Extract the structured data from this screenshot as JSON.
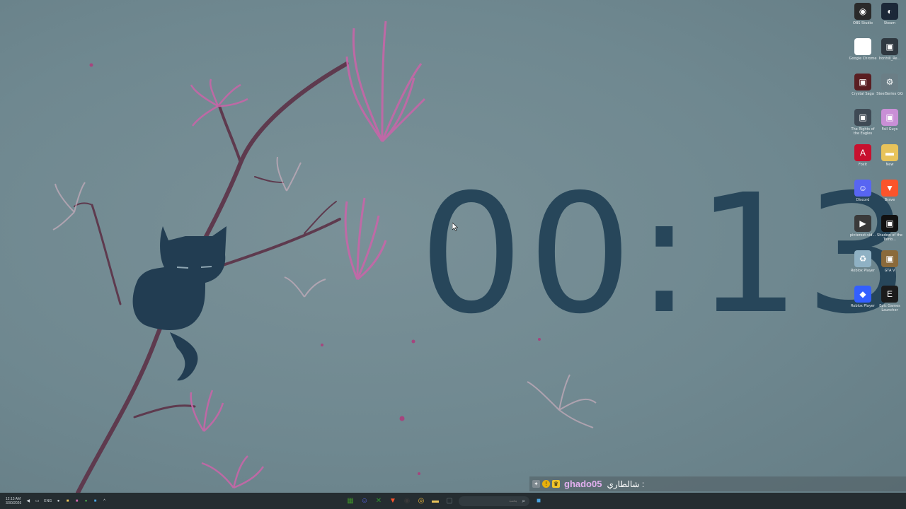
{
  "clock": {
    "time": "00:13"
  },
  "desktop_icons": [
    {
      "name": "obs-studio",
      "label": "OBS Studio",
      "icon": "obs-icon",
      "color": "#2a2a2a"
    },
    {
      "name": "steam",
      "label": "Steam",
      "icon": "steam-icon",
      "color": "#1b2838"
    },
    {
      "name": "google-chrome",
      "label": "Google Chrome",
      "icon": "chrome-icon",
      "color": "#ffffff"
    },
    {
      "name": "game-shortcut-1",
      "label": "Ironhill_Re...",
      "icon": "game-thumbnail-icon",
      "color": "#2f3840"
    },
    {
      "name": "game-shortcut-2",
      "label": "Crystal Saga",
      "icon": "game-thumbnail-icon",
      "color": "#5a1e22"
    },
    {
      "name": "steelseries-gg",
      "label": "SteelSeries GG",
      "icon": "gear-icon",
      "color": "#6b7e86"
    },
    {
      "name": "game-shortcut-3",
      "label": "The Rights of the Eagles",
      "icon": "game-thumbnail-icon",
      "color": "#3f4a55"
    },
    {
      "name": "fall-guys",
      "label": "Fall Guys",
      "icon": "game-thumbnail-icon",
      "color": "#c98fd6"
    },
    {
      "name": "adobe-app",
      "label": "Foxit",
      "icon": "adobe-icon",
      "color": "#c8102e"
    },
    {
      "name": "folder-new",
      "label": "New",
      "icon": "folder-icon",
      "color": "#e8c35a"
    },
    {
      "name": "discord",
      "label": "Discord",
      "icon": "discord-icon",
      "color": "#5865f2"
    },
    {
      "name": "brave",
      "label": "Brave",
      "icon": "brave-icon",
      "color": "#fb542b"
    },
    {
      "name": "pinterest-video",
      "label": "pinterest-vid...",
      "icon": "video-file-icon",
      "color": "#3a3a3a"
    },
    {
      "name": "game-shortcut-4",
      "label": "Shadow of the Tomb...",
      "icon": "game-thumbnail-icon",
      "color": "#111111"
    },
    {
      "name": "roblox-player-shortcut",
      "label": "Roblox Player",
      "icon": "recycle-icon",
      "color": "#8fb1c4"
    },
    {
      "name": "game-shortcut-5",
      "label": "GTA V",
      "icon": "game-thumbnail-icon",
      "color": "#8a6a3b"
    },
    {
      "name": "roblox-studio",
      "label": "Roblox Player",
      "icon": "roblox-icon",
      "color": "#335fff"
    },
    {
      "name": "epic-games",
      "label": "Epic Games Launcher",
      "icon": "epic-icon",
      "color": "#1b1b1b"
    }
  ],
  "chat": {
    "username": "ghado05",
    "message": "شالطاري :",
    "badges": [
      {
        "name": "broadcaster-badge",
        "symbol": "✦",
        "color": "#7f8a90"
      },
      {
        "name": "info-badge",
        "symbol": "!",
        "color": "#e8b10c"
      },
      {
        "name": "crown-badge",
        "symbol": "♛",
        "color": "#f2c52a"
      }
    ]
  },
  "taskbar": {
    "time": "12:13 AM",
    "date": "3/30/2026",
    "language": "ENG",
    "search_placeholder": "بحث",
    "apps": [
      {
        "name": "minecraft",
        "icon": "minecraft-icon",
        "color": "#3f8f2b"
      },
      {
        "name": "discord",
        "icon": "discord-icon",
        "color": "#5865f2"
      },
      {
        "name": "xbox",
        "icon": "xbox-icon",
        "color": "#2f8f2f"
      },
      {
        "name": "brave",
        "icon": "brave-icon",
        "color": "#fb542b"
      },
      {
        "name": "obs",
        "icon": "obs-icon",
        "color": "#3a3a3a"
      },
      {
        "name": "chrome",
        "icon": "chrome-icon",
        "color": "#e7b43a"
      },
      {
        "name": "file-explorer",
        "icon": "folder-icon",
        "color": "#e8c35a"
      },
      {
        "name": "task-view",
        "icon": "window-icon",
        "color": "#6c777c"
      }
    ]
  }
}
